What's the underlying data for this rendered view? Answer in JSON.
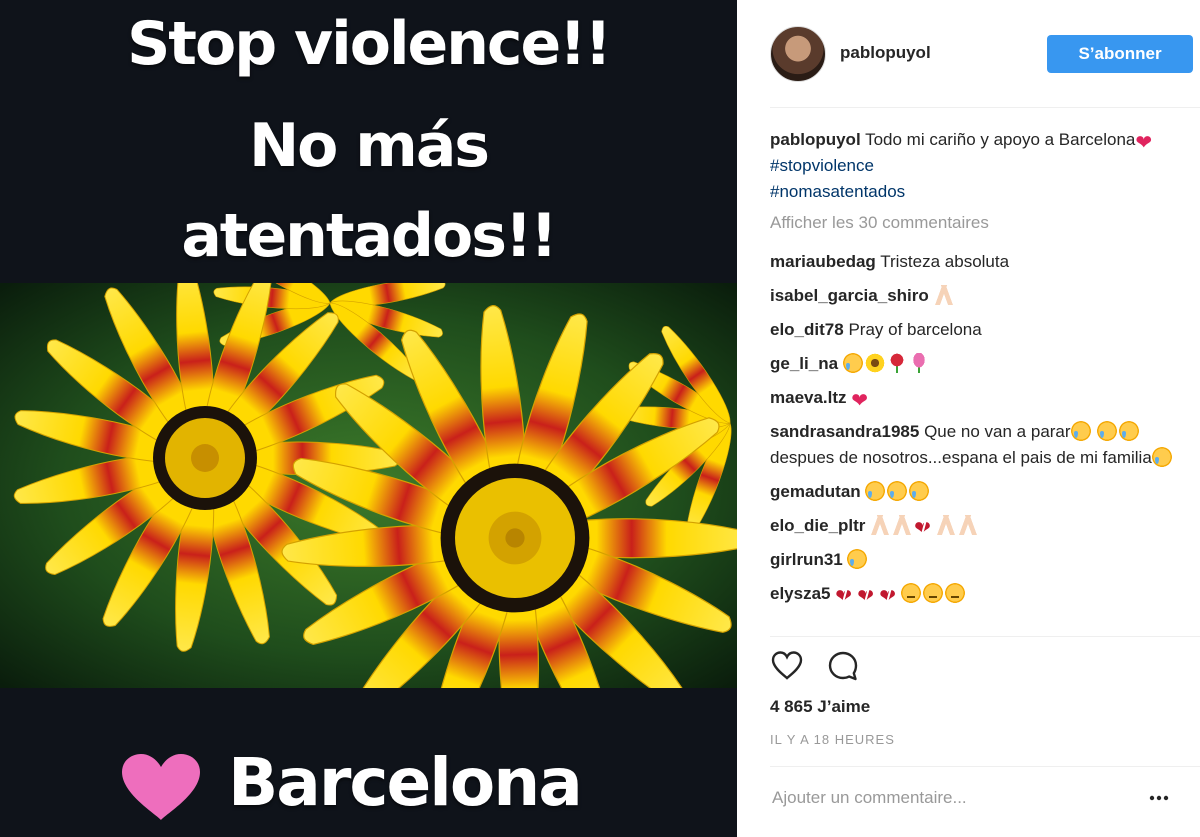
{
  "image": {
    "line1": "Stop violence!!",
    "line2": "No más",
    "line3": "atentados!!",
    "bottom_text": "Barcelona"
  },
  "header": {
    "username": "pablopuyol",
    "follow_label": "S’abonner"
  },
  "caption": {
    "username": "pablopuyol",
    "text": "Todo mi cariño y apoyo a Barcelona",
    "hashtag1": "#stopviolence",
    "hashtag2": "#nomasatentados"
  },
  "view_all_comments": "Afficher les 30 commentaires",
  "comments": [
    {
      "user": "mariaubedag",
      "text": "Tristeza absoluta"
    },
    {
      "user": "isabel_garcia_shiro",
      "text": ""
    },
    {
      "user": "elo_dit78",
      "text": "Pray of barcelona"
    },
    {
      "user": "ge_li_na",
      "text": ""
    },
    {
      "user": "maeva.ltz",
      "text": ""
    },
    {
      "user": "sandrasandra1985",
      "text1": "Que no van a parar",
      "text2": "despues de nosotros...espana el pais de mi familia"
    },
    {
      "user": "gemadutan",
      "text": ""
    },
    {
      "user": "elo_die_pltr",
      "text": ""
    },
    {
      "user": "girlrun31",
      "text": ""
    },
    {
      "user": "elysza5",
      "text": ""
    }
  ],
  "icons": {
    "like": "heart-outline-icon",
    "comment": "speech-bubble-icon",
    "more": "ellipsis-icon"
  },
  "likes_count": "4 865 J’aime",
  "timestamp": "IL Y A 18 HEURES",
  "add_comment": {
    "placeholder": "Ajouter un commentaire..."
  },
  "colors": {
    "accent": "#3897f0",
    "hashtag": "#003569",
    "image_bg": "#0f131a",
    "heart_pink": "#ee6ebd"
  }
}
